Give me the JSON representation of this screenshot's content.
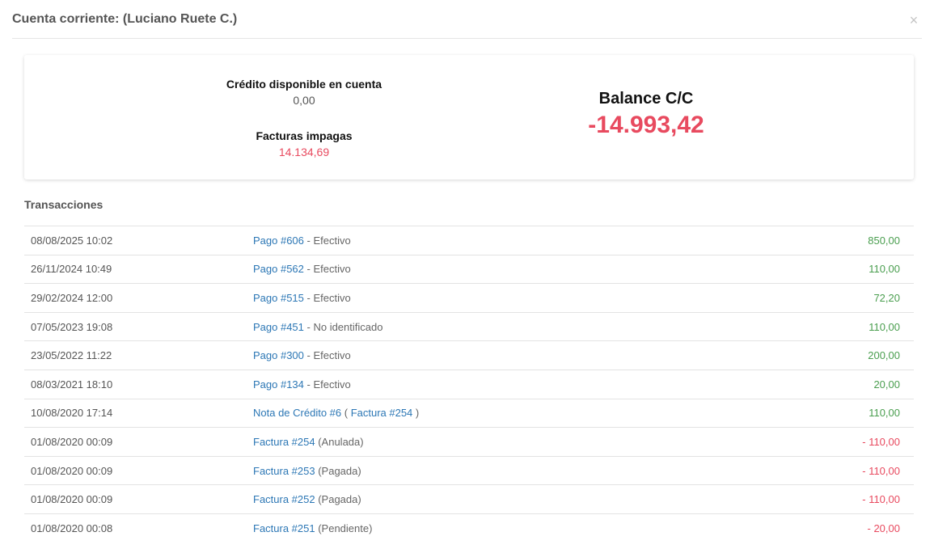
{
  "modal": {
    "title": "Cuenta corriente: (Luciano Ruete C.)",
    "close_label": "×"
  },
  "summary": {
    "credit_label": "Crédito disponible en cuenta",
    "credit_value": "0,00",
    "unpaid_label": "Facturas impagas",
    "unpaid_value": "14.134,69",
    "balance_label": "Balance C/C",
    "balance_value": "-14.993,42"
  },
  "transactions_title": "Transacciones",
  "transactions": [
    {
      "date": "08/08/2025 10:02",
      "link": "Pago #606",
      "rest": " - Efectivo",
      "amount": "850,00"
    },
    {
      "date": "26/11/2024 10:49",
      "link": "Pago #562",
      "rest": " - Efectivo",
      "amount": "110,00"
    },
    {
      "date": "29/02/2024 12:00",
      "link": "Pago #515",
      "rest": " - Efectivo",
      "amount": "72,20"
    },
    {
      "date": "07/05/2023 19:08",
      "link": "Pago #451",
      "rest": " - No identificado",
      "amount": "110,00"
    },
    {
      "date": "23/05/2022 11:22",
      "link": "Pago #300",
      "rest": " - Efectivo",
      "amount": "200,00"
    },
    {
      "date": "08/03/2021 18:10",
      "link": "Pago #134",
      "rest": " - Efectivo",
      "amount": "20,00"
    },
    {
      "date": "10/08/2020 17:14",
      "link": "Nota de Crédito #6",
      "paren_open": " ( ",
      "link2": "Factura #254",
      "paren_close": " )",
      "amount": "110,00"
    },
    {
      "date": "01/08/2020 00:09",
      "link": "Factura #254",
      "rest": " (Anulada)",
      "amount": "- 110,00"
    },
    {
      "date": "01/08/2020 00:09",
      "link": "Factura #253",
      "rest": " (Pagada)",
      "amount": "- 110,00"
    },
    {
      "date": "01/08/2020 00:09",
      "link": "Factura #252",
      "rest": " (Pagada)",
      "amount": "- 110,00"
    },
    {
      "date": "01/08/2020 00:08",
      "link": "Factura #251",
      "rest": " (Pendiente)",
      "amount": "- 20,00"
    }
  ],
  "colors": {
    "positive": "#4a9e4f",
    "negative": "#e84a5f",
    "link": "#2c77b5"
  }
}
